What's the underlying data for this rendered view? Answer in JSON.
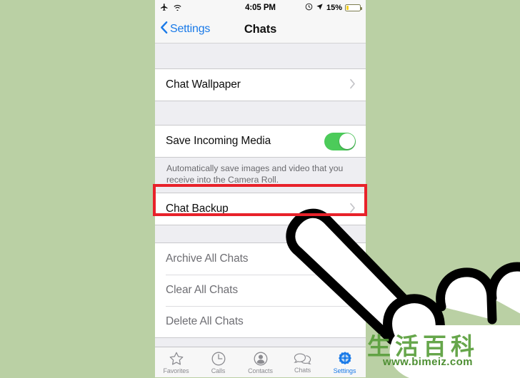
{
  "status_bar": {
    "airplane_icon": "airplane-icon",
    "wifi_icon": "wifi-icon",
    "time": "4:05 PM",
    "alarm_icon": "alarm-icon",
    "location_icon": "location-arrow-icon",
    "battery_percent": "15%",
    "battery_level": 15,
    "battery_color": "#f5d020"
  },
  "nav": {
    "back_label": "Settings",
    "title": "Chats",
    "tint_color": "#1a7ae8"
  },
  "sections": {
    "wallpaper": {
      "rows": [
        {
          "label": "Chat Wallpaper",
          "accessory": "chevron"
        }
      ]
    },
    "media": {
      "rows": [
        {
          "label": "Save Incoming Media",
          "accessory": "toggle",
          "toggle_on": true
        }
      ],
      "footnote": "Automatically save images and video that you receive into the Camera Roll."
    },
    "backup": {
      "rows": [
        {
          "label": "Chat Backup",
          "accessory": "chevron",
          "highlighted": true
        }
      ]
    },
    "destructive": {
      "rows": [
        {
          "label": "Archive All Chats"
        },
        {
          "label": "Clear All Chats"
        },
        {
          "label": "Delete All Chats"
        }
      ]
    }
  },
  "tabbar": {
    "tabs": [
      {
        "label": "Favorites",
        "icon": "star-icon",
        "active": false
      },
      {
        "label": "Calls",
        "icon": "clock-icon",
        "active": false
      },
      {
        "label": "Contacts",
        "icon": "person-icon",
        "active": false
      },
      {
        "label": "Chats",
        "icon": "speech-bubbles-icon",
        "active": false
      },
      {
        "label": "Settings",
        "icon": "gear-icon",
        "active": true
      }
    ],
    "active_color": "#1a7ae8",
    "inactive_color": "#8b8b90"
  },
  "annotation": {
    "highlight_color": "#e8222a",
    "cursor_icon": "pointing-hand-icon"
  },
  "watermark": {
    "text": "生活百科",
    "url": "www.bimeiz.com",
    "color": "#5a9f3c"
  },
  "background": {
    "color": "#bad0a4"
  }
}
